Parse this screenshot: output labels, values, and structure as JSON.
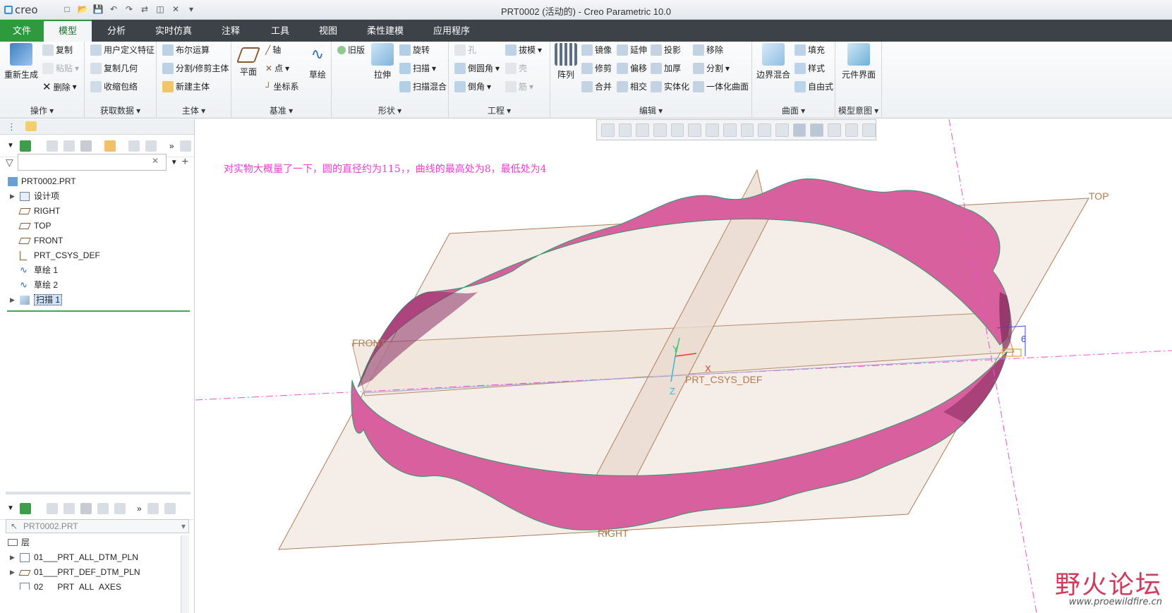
{
  "app": {
    "logo": "creo",
    "window_title": "PRT0002 (活动的) - Creo Parametric 10.0"
  },
  "tabs": [
    {
      "label": "文件"
    },
    {
      "label": "模型"
    },
    {
      "label": "分析"
    },
    {
      "label": "实时仿真"
    },
    {
      "label": "注释"
    },
    {
      "label": "工具"
    },
    {
      "label": "视图"
    },
    {
      "label": "柔性建模"
    },
    {
      "label": "应用程序"
    }
  ],
  "ribbon": {
    "operations": {
      "label": "操作",
      "regenerate": "重新生成",
      "copy": "复制",
      "paste": "粘贴",
      "delete": "删除"
    },
    "get_data": {
      "label": "获取数据",
      "udf": "用户定义特征",
      "copy_geom": "复制几何",
      "shrinkwrap": "收缩包络"
    },
    "body": {
      "label": "主体",
      "boolean": "布尔运算",
      "split_trim": "分割/修剪主体",
      "new_body": "新建主体"
    },
    "datum": {
      "label": "基准",
      "plane": "平面",
      "axis": "轴",
      "point": "点",
      "csys": "坐标系",
      "sketch": "草绘"
    },
    "shapes": {
      "label": "形状",
      "legacy": "旧版",
      "extrude": "拉伸",
      "revolve": "旋转",
      "sweep": "扫描",
      "swept_blend": "扫描混合"
    },
    "engineering": {
      "label": "工程",
      "hole": "孔",
      "round": "倒圆角",
      "chamfer": "倒角",
      "draft": "拔模",
      "shell": "壳",
      "rib": "筋"
    },
    "editing": {
      "label": "编辑",
      "pattern": "阵列",
      "mirror": "镜像",
      "trim": "修剪",
      "merge": "合并",
      "extend": "延伸",
      "offset": "偏移",
      "intersect": "相交",
      "project": "投影",
      "thicken": "加厚",
      "solidify": "实体化",
      "remove": "移除",
      "split": "分割",
      "one_surface": "一体化曲面"
    },
    "surfaces": {
      "label": "曲面",
      "boundary_blend": "边界混合",
      "fill": "填充",
      "style": "样式",
      "freestyle": "自由式"
    },
    "model_intent": {
      "label": "模型意图",
      "component_interface": "元件界面"
    }
  },
  "model_tree": {
    "filter_placeholder": "",
    "root": "PRT0002.PRT",
    "items": [
      {
        "label": "设计项",
        "icon": "design-items-icon"
      },
      {
        "label": "RIGHT",
        "icon": "datum-plane-icon"
      },
      {
        "label": "TOP",
        "icon": "datum-plane-icon"
      },
      {
        "label": "FRONT",
        "icon": "datum-plane-icon"
      },
      {
        "label": "PRT_CSYS_DEF",
        "icon": "csys-icon"
      },
      {
        "label": "草绘 1",
        "icon": "sketch-icon"
      },
      {
        "label": "草绘 2",
        "icon": "sketch-icon"
      },
      {
        "label": "扫描 1",
        "icon": "sweep-feature-icon",
        "selected": true
      }
    ]
  },
  "layer_tree": {
    "model": "PRT0002.PRT",
    "header": "层",
    "items": [
      {
        "label": "01___PRT_ALL_DTM_PLN"
      },
      {
        "label": "01___PRT_DEF_DTM_PLN"
      },
      {
        "label": "02___PRT_ALL_AXES"
      }
    ]
  },
  "graphics": {
    "note": "对实物大概量了一下，圆的直径约为115，，曲线的最高处为8，最低处为4",
    "plane_labels": {
      "front": "FRONT",
      "top": "TOP",
      "right": "RIGHT"
    },
    "csys_label": "PRT_CSYS_DEF",
    "axis_labels": {
      "x": "X",
      "y": "Y",
      "z": "Z"
    },
    "dimension": "6",
    "colors": {
      "surface": "#d9609f",
      "surface_dark": "#8a2e62",
      "plane_fill": "#f5ede6",
      "plane_edge": "#a0643c",
      "axis": "#ef4fd1",
      "note": "#f03cd2"
    }
  },
  "watermark": {
    "title": "野火论坛",
    "url": "www.proewildfire.cn"
  }
}
